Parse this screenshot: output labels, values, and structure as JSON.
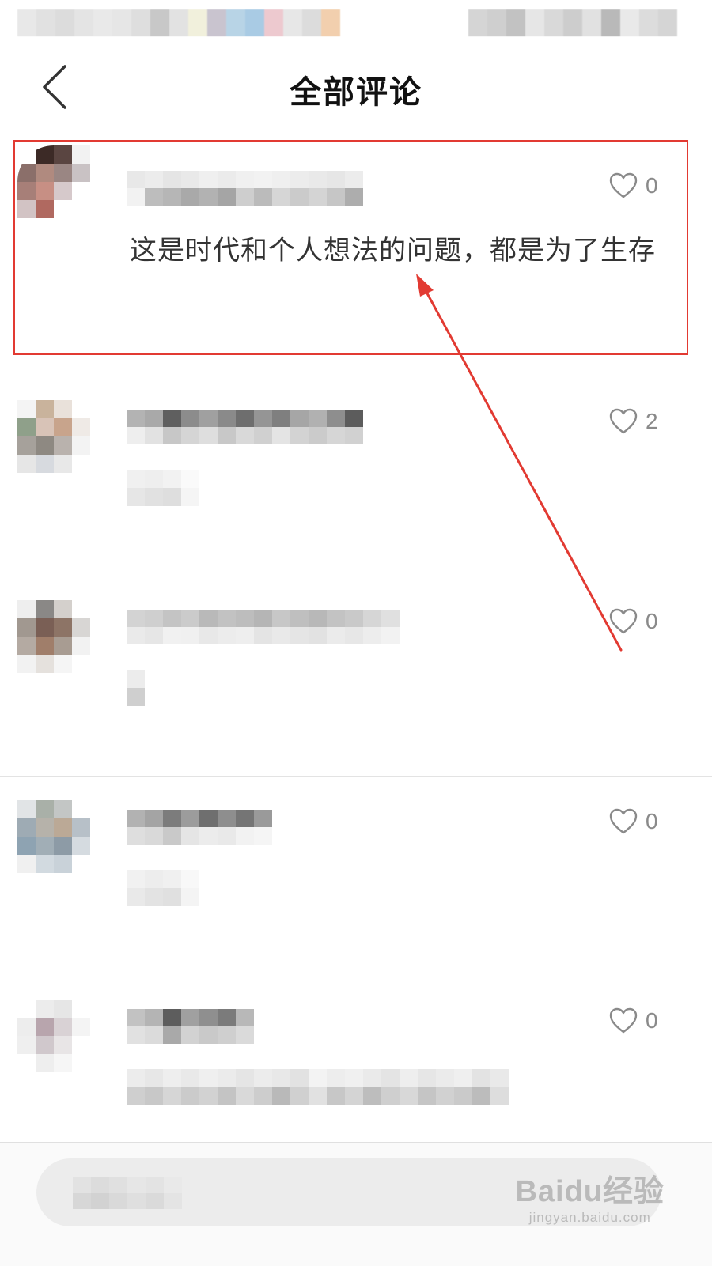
{
  "header": {
    "title": "全部评论"
  },
  "comments": [
    {
      "text": "这是时代和个人想法的问题，都是为了生存",
      "likes": "0"
    },
    {
      "text": "",
      "likes": "2"
    },
    {
      "text": "",
      "likes": "0"
    },
    {
      "text": "",
      "likes": "0"
    },
    {
      "text": "",
      "likes": "0"
    }
  ],
  "watermark": {
    "logo": "Baidu经验",
    "url": "jingyan.baidu.com"
  },
  "colors": {
    "highlight": "#e23a32",
    "divider": "#e3e3e3",
    "like_icon": "#8a8a8a"
  },
  "icons": {
    "back": "chevron-left-icon",
    "like": "heart-outline-icon"
  }
}
